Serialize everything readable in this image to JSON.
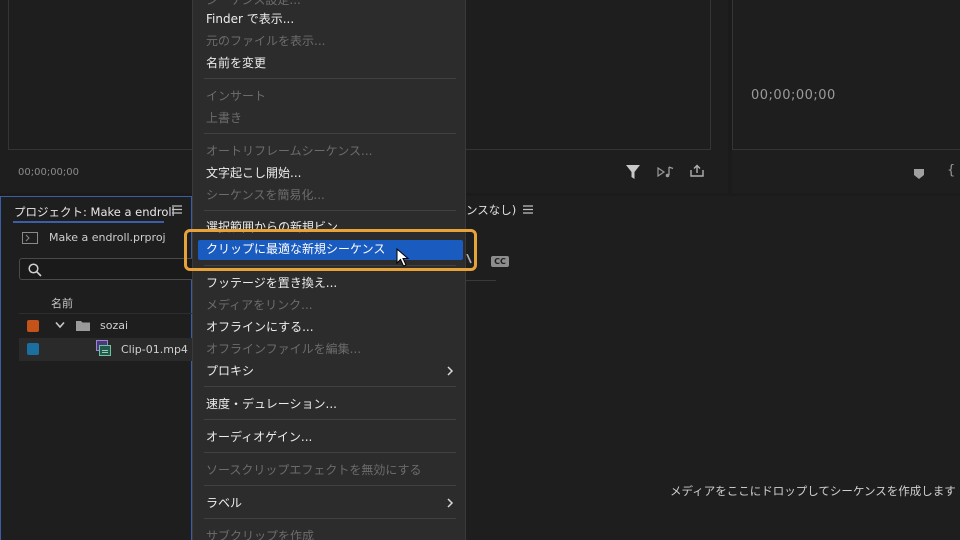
{
  "source_monitor": {
    "timecode": "00;00;00;00"
  },
  "program_monitor": {
    "timecode": "00;00;00;00",
    "brace": "{"
  },
  "project_panel": {
    "title": "プロジェクト: Make a endroll",
    "project_file": "Make a endroll.prproj",
    "search_placeholder": "",
    "column_name": "名前",
    "items": [
      {
        "label": "sozai",
        "type": "folder",
        "color": "#c4531a"
      },
      {
        "label": "Clip-01.mp4",
        "type": "clip",
        "color": "#1a6fa0"
      }
    ]
  },
  "timeline_panel": {
    "title": "ンスなし)",
    "cc_badge": "CC",
    "drop_message": "メディアをここにドロップしてシーケンスを作成します"
  },
  "context_menu": {
    "items": [
      {
        "label": "シーケンス設定...",
        "enabled": false
      },
      {
        "label": "Finder で表示...",
        "enabled": true
      },
      {
        "label": "元のファイルを表示...",
        "enabled": false
      },
      {
        "label": "名前を変更",
        "enabled": true
      },
      {
        "label": "インサート",
        "enabled": false
      },
      {
        "label": "上書き",
        "enabled": false
      },
      {
        "label": "オートリフレームシーケンス...",
        "enabled": false
      },
      {
        "label": "文字起こし開始...",
        "enabled": true
      },
      {
        "label": "シーケンスを簡易化...",
        "enabled": false
      },
      {
        "label": "選択範囲からの新規ビン",
        "enabled": true
      },
      {
        "label": "クリップに最適な新規シーケンス",
        "enabled": true,
        "highlighted": true
      },
      {
        "label": "フッテージを置き換え...",
        "enabled": true
      },
      {
        "label": "メディアをリンク...",
        "enabled": false
      },
      {
        "label": "オフラインにする...",
        "enabled": true
      },
      {
        "label": "オフラインファイルを編集...",
        "enabled": false
      },
      {
        "label": "プロキシ",
        "enabled": true,
        "submenu": true
      },
      {
        "label": "速度・デュレーション...",
        "enabled": true
      },
      {
        "label": "オーディオゲイン...",
        "enabled": true
      },
      {
        "label": "ソースクリップエフェクトを無効にする",
        "enabled": false
      },
      {
        "label": "ラベル",
        "enabled": true,
        "submenu": true
      },
      {
        "label": "サブクリップを作成",
        "enabled": false
      }
    ]
  },
  "colors": {
    "menu_bg": "#2c2c2c",
    "highlight": "#1a5bc0",
    "callout": "#e8a23a",
    "panel_focus": "#3b5ea8"
  }
}
